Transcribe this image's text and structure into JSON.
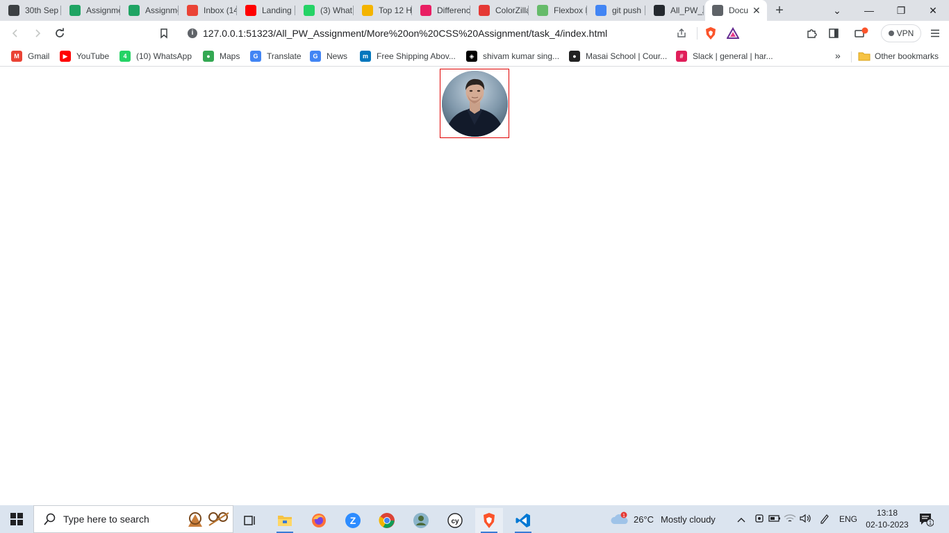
{
  "tabs": [
    {
      "title": "30th Sep",
      "icon": "wordpress-icon",
      "color": "#3c4043"
    },
    {
      "title": "Assignme",
      "icon": "google-drive-icon",
      "color": "#1fa463"
    },
    {
      "title": "Assignme",
      "icon": "google-drive-icon",
      "color": "#1fa463"
    },
    {
      "title": "Inbox (14",
      "icon": "gmail-icon",
      "color": "#ea4335"
    },
    {
      "title": "Landing",
      "icon": "youtube-icon",
      "color": "#ff0000"
    },
    {
      "title": "(3) What",
      "icon": "whatsapp-icon",
      "color": "#25d366"
    },
    {
      "title": "Top 12 H",
      "icon": "colorful-circle-icon",
      "color": "#f4b400"
    },
    {
      "title": "Differenc",
      "icon": "cube-icon",
      "color": "#e91e63"
    },
    {
      "title": "ColorZilla",
      "icon": "colorzilla-icon",
      "color": "#e53935"
    },
    {
      "title": "Flexbox F",
      "icon": "frog-icon",
      "color": "#66bb6a"
    },
    {
      "title": "git push",
      "icon": "google-icon",
      "color": "#4285f4"
    },
    {
      "title": "All_PW_A",
      "icon": "github-icon",
      "color": "#24292e"
    },
    {
      "title": "Docu",
      "icon": "globe-icon",
      "color": "#5f6368",
      "active": true
    }
  ],
  "window_controls": {
    "chevron": "⌄",
    "minimize": "—",
    "restore": "❐",
    "close": "✕"
  },
  "new_tab_label": "+",
  "address_bar": {
    "url": "127.0.0.1:51323/All_PW_Assignment/More%20on%20CSS%20Assignment/task_4/index.html"
  },
  "vpn_label": "VPN",
  "bookmarks": [
    {
      "label": "Gmail",
      "icon": "gmail-icon",
      "color": "#ea4335",
      "glyph": "M"
    },
    {
      "label": "YouTube",
      "icon": "youtube-icon",
      "color": "#ff0000",
      "glyph": "▶"
    },
    {
      "label": "(10) WhatsApp",
      "icon": "whatsapp-icon",
      "color": "#25d366",
      "glyph": "4"
    },
    {
      "label": "Maps",
      "icon": "maps-pin-icon",
      "color": "#34a853",
      "glyph": "●"
    },
    {
      "label": "Translate",
      "icon": "translate-icon",
      "color": "#4285f4",
      "glyph": "G"
    },
    {
      "label": "News",
      "icon": "news-icon",
      "color": "#4285f4",
      "glyph": "G"
    },
    {
      "label": "Free Shipping Abov...",
      "icon": "myntra-icon",
      "color": "#0277bd",
      "glyph": "m"
    },
    {
      "label": "shivam kumar sing...",
      "icon": "codepen-icon",
      "color": "#000000",
      "glyph": "◈"
    },
    {
      "label": "Masai School | Cour...",
      "icon": "masai-icon",
      "color": "#222222",
      "glyph": "●"
    },
    {
      "label": "Slack | general | har...",
      "icon": "slack-icon",
      "color": "#e01e5a",
      "glyph": "#"
    }
  ],
  "bookmarks_more": "»",
  "other_bookmarks": "Other bookmarks",
  "page": {
    "image_alt_icon": "portrait-photo",
    "frame_color": "#e00000"
  },
  "taskbar": {
    "search_placeholder": "Type here to search",
    "apps": [
      {
        "name": "task-view-icon"
      },
      {
        "name": "file-explorer-icon"
      },
      {
        "name": "firefox-icon"
      },
      {
        "name": "zoom-icon"
      },
      {
        "name": "chrome-icon"
      },
      {
        "name": "people-icon"
      },
      {
        "name": "cypress-icon"
      },
      {
        "name": "brave-icon",
        "active": true
      },
      {
        "name": "vscode-icon",
        "active": true
      }
    ],
    "weather": {
      "temp": "26°C",
      "desc": "Mostly cloudy",
      "badge": "1"
    },
    "language": "ENG",
    "time": "13:18",
    "date": "02-10-2023",
    "notification_count": "1"
  }
}
